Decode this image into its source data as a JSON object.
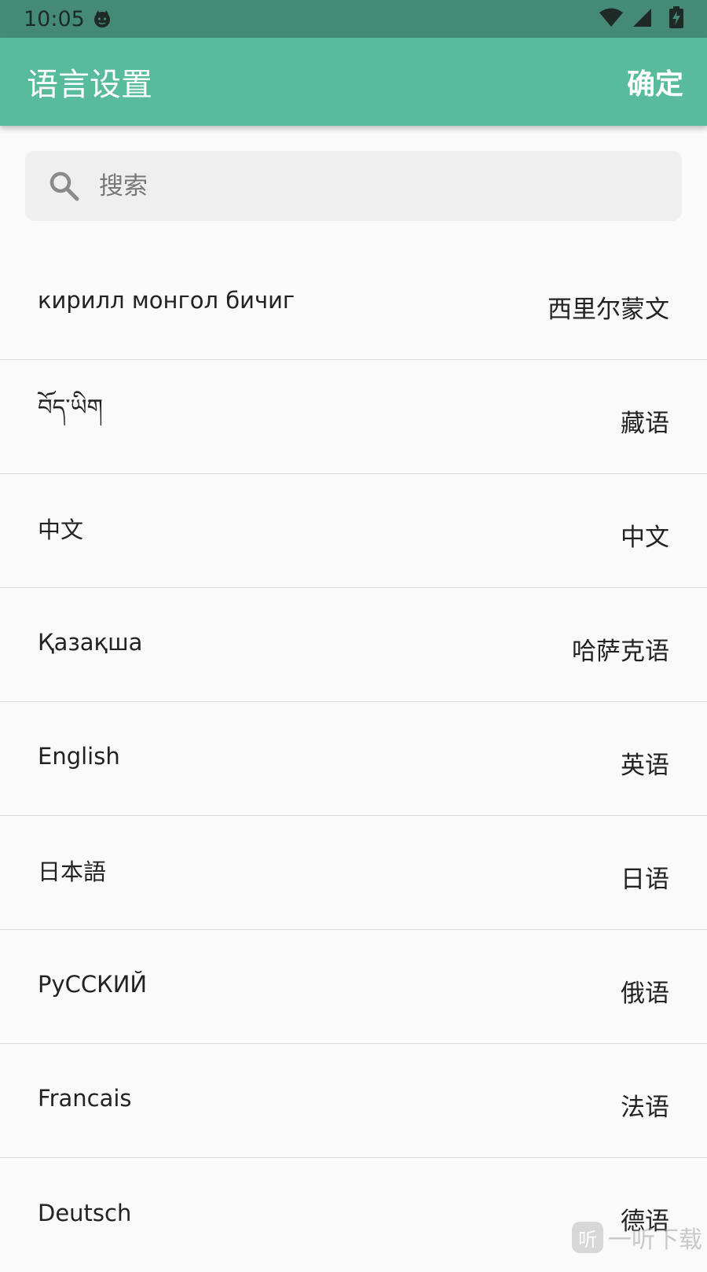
{
  "status_bar": {
    "time": "10:05",
    "icons": [
      "cat-notification-icon",
      "wifi-icon",
      "cellular-signal-icon",
      "battery-charging-icon"
    ]
  },
  "app_bar": {
    "title": "语言设置",
    "confirm_label": "确定",
    "background_color": "#58bc9c"
  },
  "search": {
    "placeholder": "搜索"
  },
  "languages": [
    {
      "native": "кирилл монгол бичиг",
      "chinese": "西里尔蒙文"
    },
    {
      "native": "བོད་ཡིག",
      "chinese": "藏语"
    },
    {
      "native": "中文",
      "chinese": "中文"
    },
    {
      "native": "Қазақша",
      "chinese": "哈萨克语"
    },
    {
      "native": "English",
      "chinese": "英语"
    },
    {
      "native": "日本語",
      "chinese": "日语"
    },
    {
      "native": "РуССКИЙ",
      "chinese": "俄语"
    },
    {
      "native": "Francais",
      "chinese": "法语"
    },
    {
      "native": "Deutsch",
      "chinese": "德语"
    }
  ],
  "watermark": {
    "badge": "听",
    "text": "一听下载"
  }
}
